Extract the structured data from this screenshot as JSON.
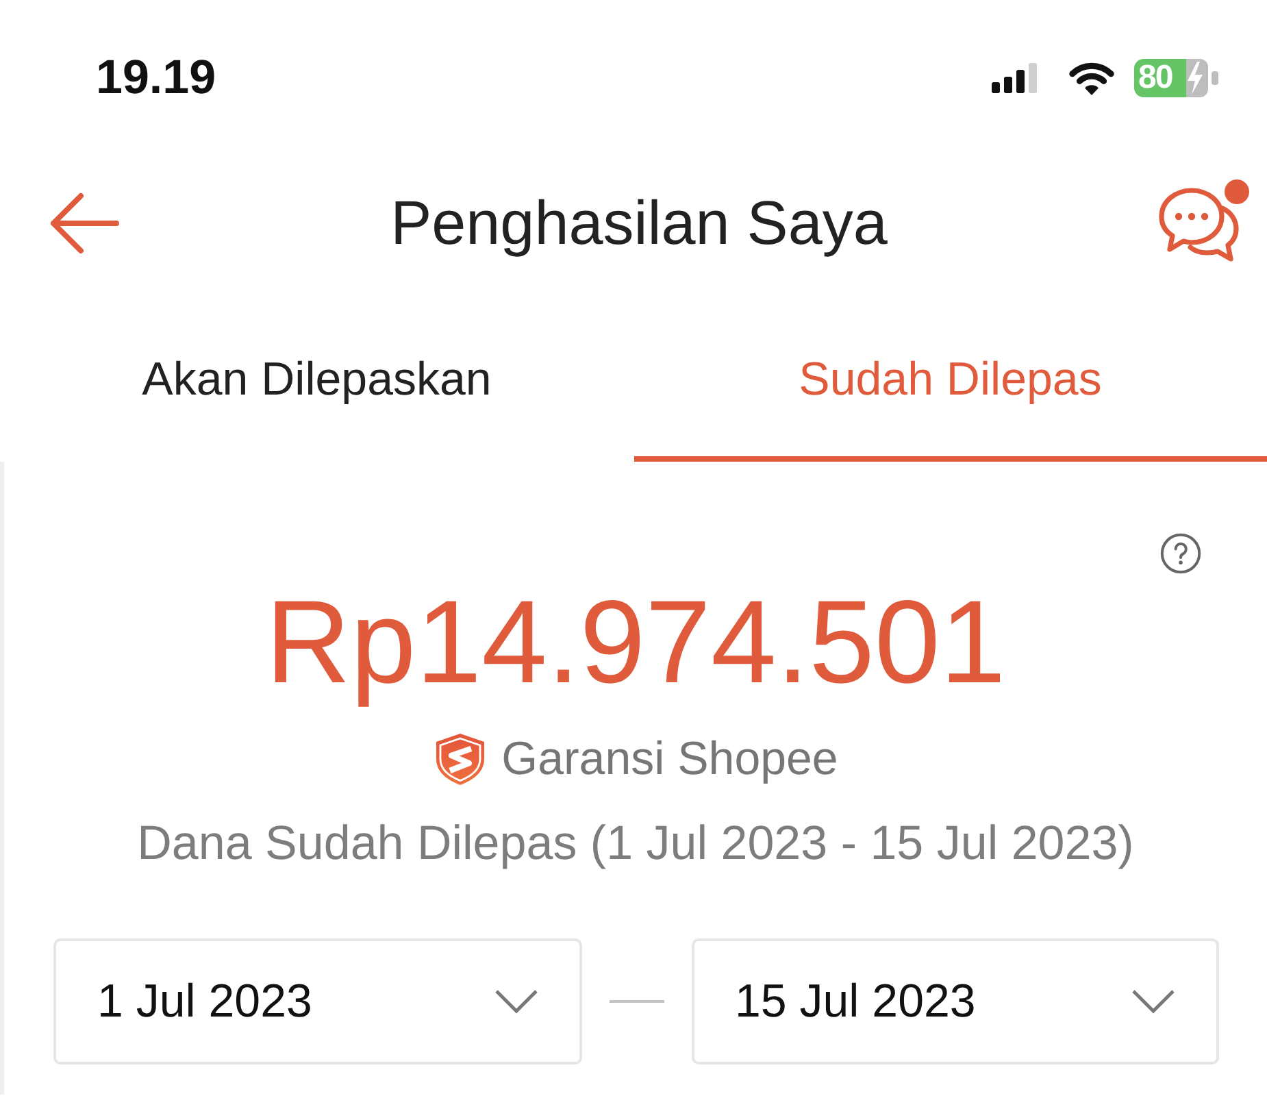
{
  "status_bar": {
    "time": "19.19",
    "battery": "80"
  },
  "header": {
    "title": "Penghasilan Saya",
    "chat_unread": true
  },
  "tabs": [
    {
      "label": "Akan Dilepaskan",
      "selected": false
    },
    {
      "label": "Sudah Dilepas",
      "selected": true
    }
  ],
  "summary": {
    "amount": "Rp14.974.501",
    "guarantee": "Garansi Shopee",
    "caption": "Dana Sudah Dilepas (1 Jul 2023 - 15 Jul 2023)"
  },
  "date_range": {
    "start": "1 Jul 2023",
    "end": "15 Jul 2023"
  }
}
